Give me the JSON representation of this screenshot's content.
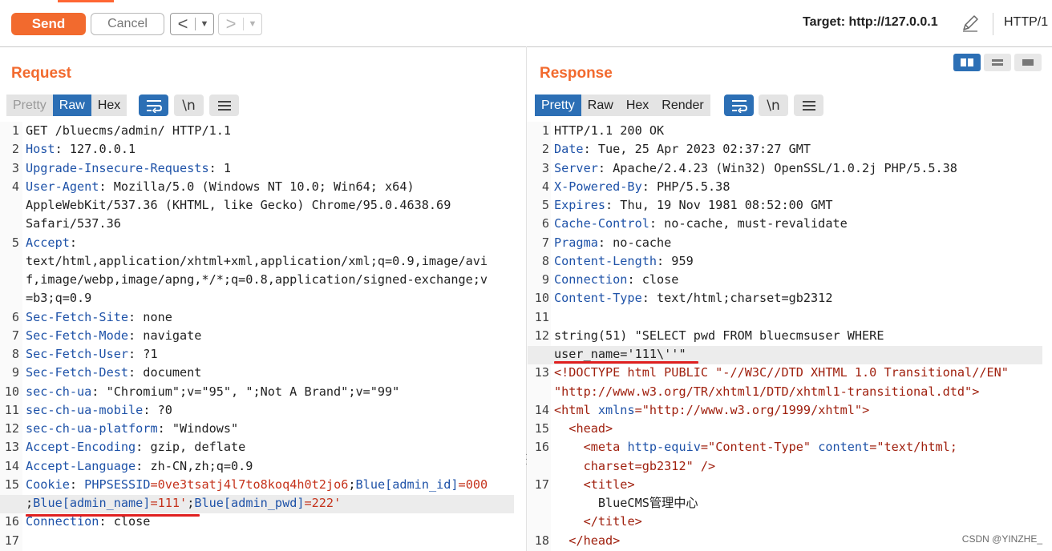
{
  "toolbar": {
    "send_label": "Send",
    "cancel_label": "Cancel",
    "target_label": "Target: http://127.0.0.1",
    "protocol_label": "HTTP/1"
  },
  "colors": {
    "accent": "#f26a2e",
    "tab_active": "#2c6fb5",
    "header_key": "#1e52a8",
    "value_red": "#c5321b",
    "underline": "#e02020"
  },
  "request": {
    "title": "Request",
    "tabs": [
      "Pretty",
      "Raw",
      "Hex"
    ],
    "active_tab": "Raw",
    "tools": [
      "wrap-lines-icon",
      "newline-toggle-icon",
      "menu-icon"
    ],
    "newline_label": "\\n"
  },
  "response": {
    "title": "Response",
    "tabs": [
      "Pretty",
      "Raw",
      "Hex",
      "Render"
    ],
    "active_tab": "Pretty",
    "tools": [
      "wrap-lines-icon",
      "newline-toggle-icon",
      "menu-icon"
    ],
    "newline_label": "\\n"
  },
  "request_lines": [
    {
      "n": "1",
      "segs": [
        {
          "t": "GET /bluecms/admin/ HTTP/1.1"
        }
      ]
    },
    {
      "n": "2",
      "segs": [
        {
          "t": "Host",
          "c": "hk"
        },
        {
          "t": ": 127.0.0.1"
        }
      ]
    },
    {
      "n": "3",
      "segs": [
        {
          "t": "Upgrade-Insecure-Requests",
          "c": "hk"
        },
        {
          "t": ": 1"
        }
      ]
    },
    {
      "n": "4",
      "segs": [
        {
          "t": "User-Agent",
          "c": "hk"
        },
        {
          "t": ": Mozilla/5.0 (Windows NT 10.0; Win64; x64)"
        }
      ]
    },
    {
      "n": "",
      "segs": [
        {
          "t": "AppleWebKit/537.36 (KHTML, like Gecko) Chrome/95.0.4638.69"
        }
      ]
    },
    {
      "n": "",
      "segs": [
        {
          "t": "Safari/537.36"
        }
      ]
    },
    {
      "n": "5",
      "segs": [
        {
          "t": "Accept",
          "c": "hk"
        },
        {
          "t": ":"
        }
      ]
    },
    {
      "n": "",
      "segs": [
        {
          "t": "text/html,application/xhtml+xml,application/xml;q=0.9,image/avi"
        }
      ]
    },
    {
      "n": "",
      "segs": [
        {
          "t": "f,image/webp,image/apng,*/*;q=0.8,application/signed-exchange;v"
        }
      ]
    },
    {
      "n": "",
      "segs": [
        {
          "t": "=b3;q=0.9"
        }
      ]
    },
    {
      "n": "6",
      "segs": [
        {
          "t": "Sec-Fetch-Site",
          "c": "hk"
        },
        {
          "t": ": none"
        }
      ]
    },
    {
      "n": "7",
      "segs": [
        {
          "t": "Sec-Fetch-Mode",
          "c": "hk"
        },
        {
          "t": ": navigate"
        }
      ]
    },
    {
      "n": "8",
      "segs": [
        {
          "t": "Sec-Fetch-User",
          "c": "hk"
        },
        {
          "t": ": ?1"
        }
      ]
    },
    {
      "n": "9",
      "segs": [
        {
          "t": "Sec-Fetch-Dest",
          "c": "hk"
        },
        {
          "t": ": document"
        }
      ]
    },
    {
      "n": "10",
      "segs": [
        {
          "t": "sec-ch-ua",
          "c": "hk"
        },
        {
          "t": ": \"Chromium\";v=\"95\", \";Not A Brand\";v=\"99\""
        }
      ]
    },
    {
      "n": "11",
      "segs": [
        {
          "t": "sec-ch-ua-mobile",
          "c": "hk"
        },
        {
          "t": ": ?0"
        }
      ]
    },
    {
      "n": "12",
      "segs": [
        {
          "t": "sec-ch-ua-platform",
          "c": "hk"
        },
        {
          "t": ": \"Windows\""
        }
      ]
    },
    {
      "n": "13",
      "segs": [
        {
          "t": "Accept-Encoding",
          "c": "hk"
        },
        {
          "t": ": gzip, deflate"
        }
      ]
    },
    {
      "n": "14",
      "segs": [
        {
          "t": "Accept-Language",
          "c": "hk"
        },
        {
          "t": ": zh-CN,zh;q=0.9"
        }
      ]
    },
    {
      "n": "15",
      "segs": [
        {
          "t": "Cookie",
          "c": "hk"
        },
        {
          "t": ": "
        },
        {
          "t": "PHPSESSID",
          "c": "hk"
        },
        {
          "t": "=",
          "c": "red"
        },
        {
          "t": "0ve3tsatj4l7to8koq4h0t2jo6",
          "c": "red"
        },
        {
          "t": ";"
        },
        {
          "t": "Blue[admin_id]",
          "c": "hk"
        },
        {
          "t": "=000",
          "c": "red"
        }
      ]
    },
    {
      "n": "",
      "segs": [
        {
          "t": ";"
        },
        {
          "t": "Blue[admin_name]",
          "c": "hk"
        },
        {
          "t": "=111'",
          "c": "red"
        },
        {
          "t": ";"
        },
        {
          "t": "Blue[admin_pwd]",
          "c": "hk"
        },
        {
          "t": "=222'",
          "c": "red"
        }
      ]
    },
    {
      "n": "16",
      "segs": [
        {
          "t": "Connection",
          "c": "hk"
        },
        {
          "t": ": close"
        }
      ]
    },
    {
      "n": "17",
      "segs": [
        {
          "t": ""
        }
      ]
    }
  ],
  "response_lines": [
    {
      "n": "1",
      "segs": [
        {
          "t": "HTTP/1.1 200 OK"
        }
      ]
    },
    {
      "n": "2",
      "segs": [
        {
          "t": "Date",
          "c": "hk"
        },
        {
          "t": ": Tue, 25 Apr 2023 02:37:27 GMT"
        }
      ]
    },
    {
      "n": "3",
      "segs": [
        {
          "t": "Server",
          "c": "hk"
        },
        {
          "t": ": Apache/2.4.23 (Win32) OpenSSL/1.0.2j PHP/5.5.38"
        }
      ]
    },
    {
      "n": "4",
      "segs": [
        {
          "t": "X-Powered-By",
          "c": "hk"
        },
        {
          "t": ": PHP/5.5.38"
        }
      ]
    },
    {
      "n": "5",
      "segs": [
        {
          "t": "Expires",
          "c": "hk"
        },
        {
          "t": ": Thu, 19 Nov 1981 08:52:00 GMT"
        }
      ]
    },
    {
      "n": "6",
      "segs": [
        {
          "t": "Cache-Control",
          "c": "hk"
        },
        {
          "t": ": no-cache, must-revalidate"
        }
      ]
    },
    {
      "n": "7",
      "segs": [
        {
          "t": "Pragma",
          "c": "hk"
        },
        {
          "t": ": no-cache"
        }
      ]
    },
    {
      "n": "8",
      "segs": [
        {
          "t": "Content-Length",
          "c": "hk"
        },
        {
          "t": ": 959"
        }
      ]
    },
    {
      "n": "9",
      "segs": [
        {
          "t": "Connection",
          "c": "hk"
        },
        {
          "t": ": close"
        }
      ]
    },
    {
      "n": "10",
      "segs": [
        {
          "t": "Content-Type",
          "c": "hk"
        },
        {
          "t": ": text/html;charset=gb2312"
        }
      ]
    },
    {
      "n": "11",
      "segs": [
        {
          "t": ""
        }
      ]
    },
    {
      "n": "12",
      "segs": [
        {
          "t": "string(51) \"SELECT pwd FROM bluecmsuser WHERE"
        }
      ]
    },
    {
      "n": "",
      "segs": [
        {
          "t": "user_name='111\\''\""
        }
      ]
    },
    {
      "n": "13",
      "segs": [
        {
          "t": "<!DOCTYPE html PUBLIC \"-//W3C//DTD XHTML 1.0 Transitional//EN\"",
          "c": "tag"
        }
      ]
    },
    {
      "n": "",
      "segs": [
        {
          "t": "\"http://www.w3.org/TR/xhtml1/DTD/xhtml1-transitional.dtd\">",
          "c": "tag"
        }
      ]
    },
    {
      "n": "14",
      "segs": [
        {
          "t": "<",
          "c": "tag"
        },
        {
          "t": "html",
          "c": "tag"
        },
        {
          "t": " xmlns",
          "c": "attr"
        },
        {
          "t": "=",
          "c": "tag"
        },
        {
          "t": "\"http://www.w3.org/1999/xhtml\"",
          "c": "aval"
        },
        {
          "t": ">",
          "c": "tag"
        }
      ]
    },
    {
      "n": "15",
      "segs": [
        {
          "t": "  "
        },
        {
          "t": "<head>",
          "c": "tag"
        }
      ]
    },
    {
      "n": "16",
      "segs": [
        {
          "t": "    "
        },
        {
          "t": "<meta",
          "c": "tag"
        },
        {
          "t": " http-equiv",
          "c": "attr"
        },
        {
          "t": "=",
          "c": "tag"
        },
        {
          "t": "\"Content-Type\"",
          "c": "aval"
        },
        {
          "t": " content",
          "c": "attr"
        },
        {
          "t": "=",
          "c": "tag"
        },
        {
          "t": "\"text/html;",
          "c": "aval"
        }
      ]
    },
    {
      "n": "",
      "segs": [
        {
          "t": "    "
        },
        {
          "t": "charset=gb2312\"",
          "c": "aval"
        },
        {
          "t": " />",
          "c": "tag"
        }
      ]
    },
    {
      "n": "17",
      "segs": [
        {
          "t": "    "
        },
        {
          "t": "<title>",
          "c": "tag"
        }
      ]
    },
    {
      "n": "",
      "segs": [
        {
          "t": "      BlueCMS管理中心"
        }
      ]
    },
    {
      "n": "",
      "segs": [
        {
          "t": "    "
        },
        {
          "t": "</title>",
          "c": "tag"
        }
      ]
    },
    {
      "n": "18",
      "segs": [
        {
          "t": "  "
        },
        {
          "t": "</head>",
          "c": "tag"
        }
      ]
    }
  ],
  "watermark": "CSDN @YINZHE_"
}
